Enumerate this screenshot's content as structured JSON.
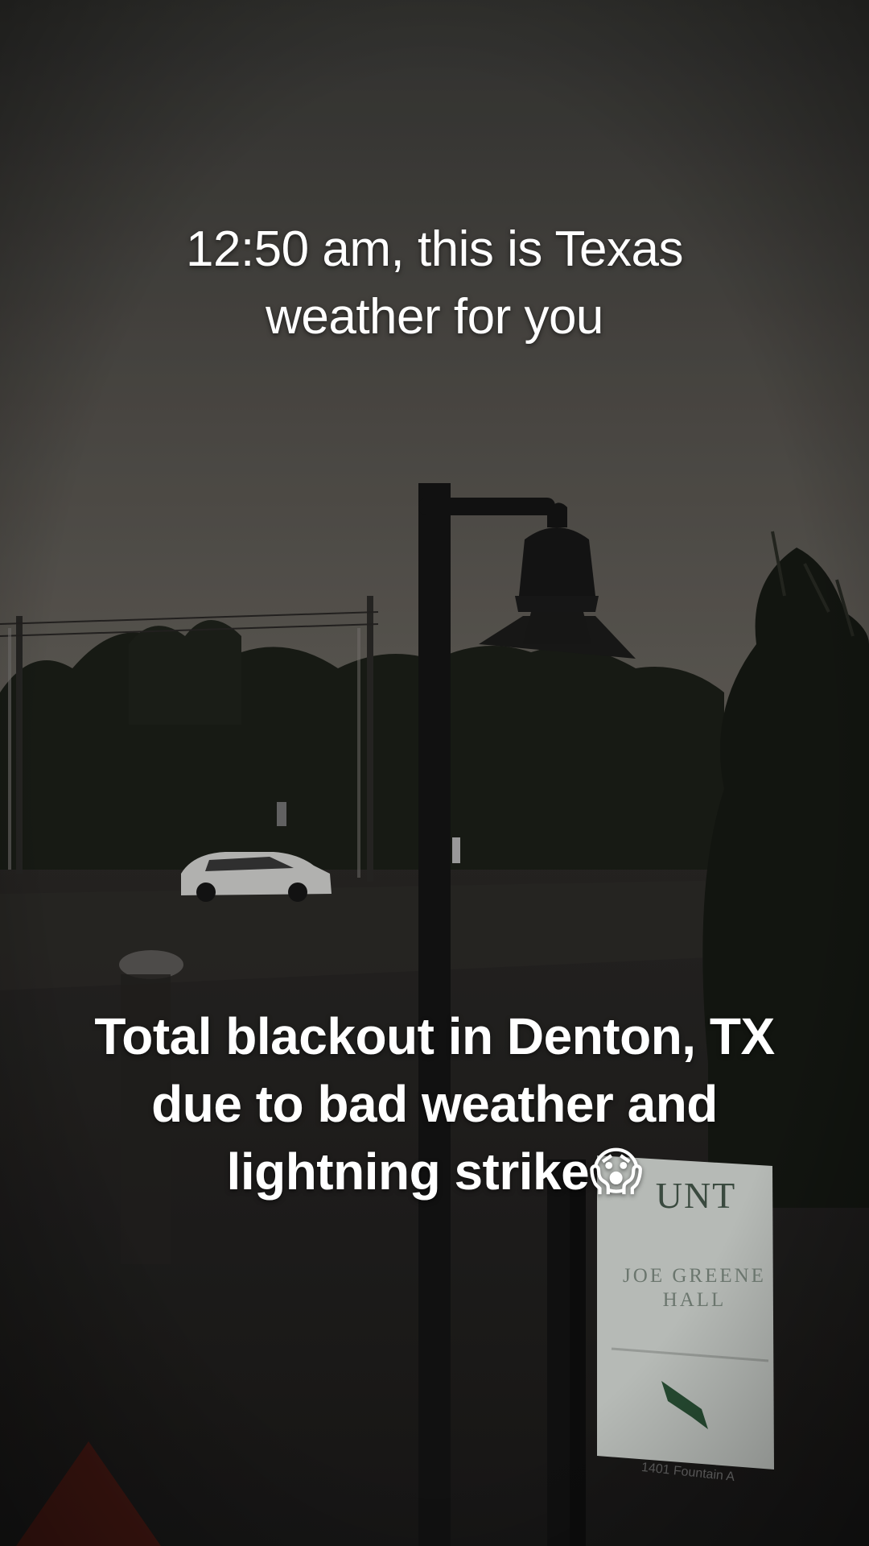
{
  "caption_top": {
    "line1": "12:50 am, this is Texas",
    "line2": "weather for you"
  },
  "caption_bottom": {
    "line1": "Total blackout in Denton, TX",
    "line2": "due to bad weather and",
    "line3": "lightning strike",
    "emoji": "😱"
  },
  "sign": {
    "title": "UNT",
    "subtitle_line1": "JOE GREENE",
    "subtitle_line2": "HALL",
    "footer": "1401 Fountain A"
  },
  "colors": {
    "sky_top": "#3f3f3c",
    "sky_horizon": "#6c6862",
    "tree_dark": "#1b1e18",
    "ground": "#242322",
    "sign_panel": "#dfe3df"
  }
}
